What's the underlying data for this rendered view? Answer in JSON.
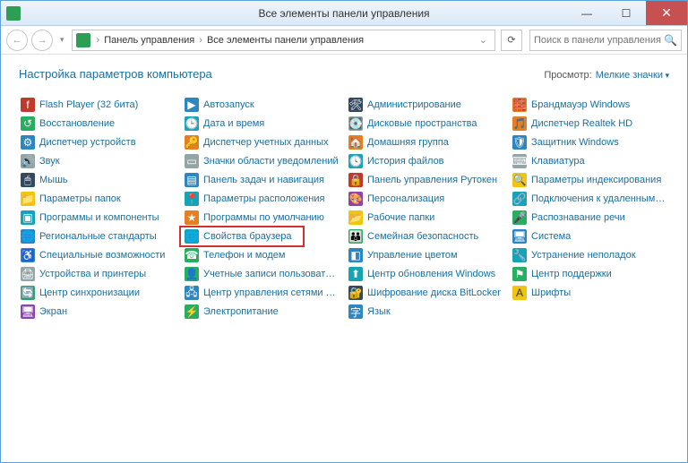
{
  "window": {
    "title": "Все элементы панели управления"
  },
  "breadcrumb": {
    "root": "Панель управления",
    "current": "Все элементы панели управления"
  },
  "search": {
    "placeholder": "Поиск в панели управления"
  },
  "header": {
    "title": "Настройка параметров компьютера",
    "view_label": "Просмотр:",
    "view_value": "Мелкие значки"
  },
  "highlight_item": "Свойства браузера",
  "columns": [
    [
      {
        "label": "Flash Player (32 бита)",
        "icon": "f",
        "cls": "ic-red"
      },
      {
        "label": "Восстановление",
        "icon": "↺",
        "cls": "ic-green"
      },
      {
        "label": "Диспетчер устройств",
        "icon": "⚙",
        "cls": "ic-blue"
      },
      {
        "label": "Звук",
        "icon": "🔊",
        "cls": "ic-gray"
      },
      {
        "label": "Мышь",
        "icon": "🖱",
        "cls": "ic-dark"
      },
      {
        "label": "Параметры папок",
        "icon": "📁",
        "cls": "ic-yellow"
      },
      {
        "label": "Программы и компоненты",
        "icon": "▣",
        "cls": "ic-cyan"
      },
      {
        "label": "Региональные стандарты",
        "icon": "🌐",
        "cls": "ic-blue"
      },
      {
        "label": "Специальные возможности",
        "icon": "♿",
        "cls": "ic-blue"
      },
      {
        "label": "Устройства и принтеры",
        "icon": "🖨",
        "cls": "ic-gray"
      },
      {
        "label": "Центр синхронизации",
        "icon": "🔄",
        "cls": "ic-green"
      },
      {
        "label": "Экран",
        "icon": "🖥",
        "cls": "ic-purple"
      }
    ],
    [
      {
        "label": "Автозапуск",
        "icon": "▶",
        "cls": "ic-blue"
      },
      {
        "label": "Дата и время",
        "icon": "🕒",
        "cls": "ic-cyan"
      },
      {
        "label": "Диспетчер учетных данных",
        "icon": "🔑",
        "cls": "ic-orange"
      },
      {
        "label": "Значки области уведомлений",
        "icon": "▭",
        "cls": "ic-gray"
      },
      {
        "label": "Панель задач и навигация",
        "icon": "▤",
        "cls": "ic-blue"
      },
      {
        "label": "Параметры расположения",
        "icon": "📍",
        "cls": "ic-cyan"
      },
      {
        "label": "Программы по умолчанию",
        "icon": "★",
        "cls": "ic-orange"
      },
      {
        "label": "Свойства браузера",
        "icon": "🌐",
        "cls": "ic-cyan"
      },
      {
        "label": "Телефон и модем",
        "icon": "☎",
        "cls": "ic-green"
      },
      {
        "label": "Учетные записи пользователей",
        "icon": "👤",
        "cls": "ic-green"
      },
      {
        "label": "Центр управления сетями и общи…",
        "icon": "🖧",
        "cls": "ic-blue"
      },
      {
        "label": "Электропитание",
        "icon": "⚡",
        "cls": "ic-green"
      }
    ],
    [
      {
        "label": "Администрирование",
        "icon": "🛠",
        "cls": "ic-dark"
      },
      {
        "label": "Дисковые пространства",
        "icon": "💽",
        "cls": "ic-gray"
      },
      {
        "label": "Домашняя группа",
        "icon": "🏠",
        "cls": "ic-orange"
      },
      {
        "label": "История файлов",
        "icon": "🕓",
        "cls": "ic-cyan"
      },
      {
        "label": "Панель управления Рутокен",
        "icon": "🔒",
        "cls": "ic-red"
      },
      {
        "label": "Персонализация",
        "icon": "🎨",
        "cls": "ic-purple"
      },
      {
        "label": "Рабочие папки",
        "icon": "📂",
        "cls": "ic-yellow"
      },
      {
        "label": "Семейная безопасность",
        "icon": "👪",
        "cls": "ic-green"
      },
      {
        "label": "Управление цветом",
        "icon": "◧",
        "cls": "ic-blue"
      },
      {
        "label": "Центр обновления Windows",
        "icon": "⬆",
        "cls": "ic-cyan"
      },
      {
        "label": "Шифрование диска BitLocker",
        "icon": "🔐",
        "cls": "ic-dark"
      },
      {
        "label": "Язык",
        "icon": "字",
        "cls": "ic-blue"
      }
    ],
    [
      {
        "label": "Брандмауэр Windows",
        "icon": "🧱",
        "cls": "ic-orange"
      },
      {
        "label": "Диспетчер Realtek HD",
        "icon": "🎵",
        "cls": "ic-orange"
      },
      {
        "label": "Защитник Windows",
        "icon": "🛡",
        "cls": "ic-blue"
      },
      {
        "label": "Клавиатура",
        "icon": "⌨",
        "cls": "ic-gray"
      },
      {
        "label": "Параметры индексирования",
        "icon": "🔍",
        "cls": "ic-yellow"
      },
      {
        "label": "Подключения к удаленным рабоч…",
        "icon": "🔗",
        "cls": "ic-cyan"
      },
      {
        "label": "Распознавание речи",
        "icon": "🎤",
        "cls": "ic-green"
      },
      {
        "label": "Система",
        "icon": "🖥",
        "cls": "ic-blue"
      },
      {
        "label": "Устранение неполадок",
        "icon": "🔧",
        "cls": "ic-cyan"
      },
      {
        "label": "Центр поддержки",
        "icon": "⚑",
        "cls": "ic-green"
      },
      {
        "label": "Шрифты",
        "icon": "A",
        "cls": "ic-yellow"
      }
    ]
  ]
}
